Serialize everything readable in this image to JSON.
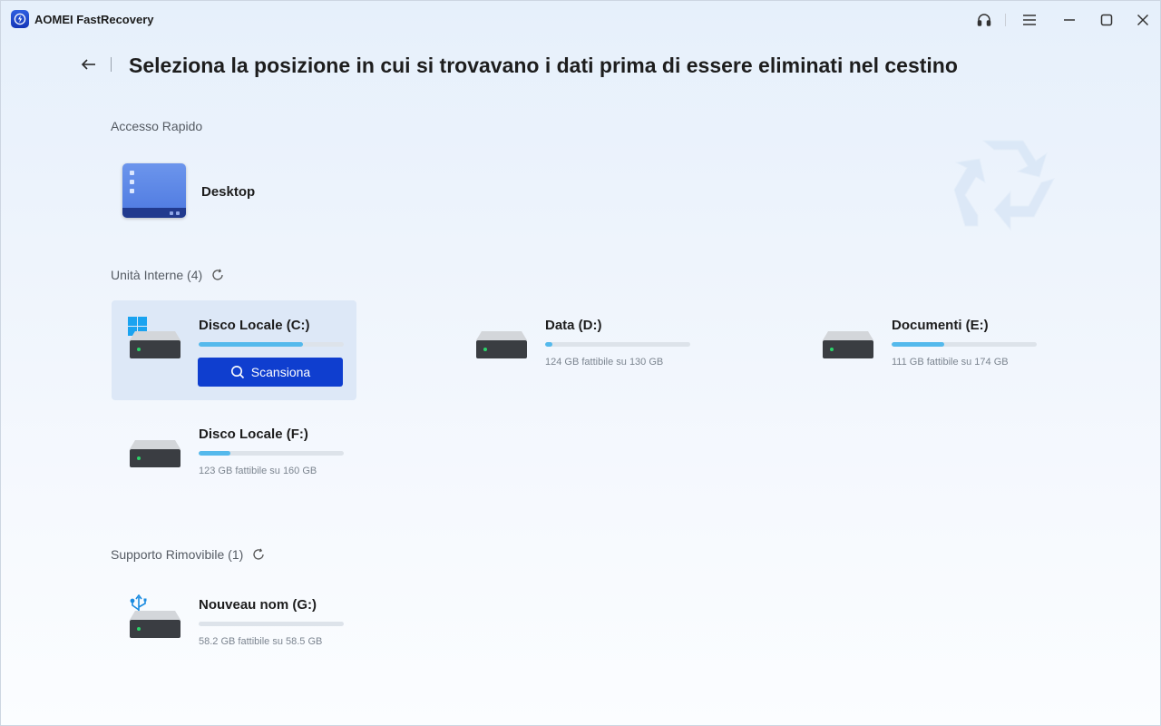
{
  "app": {
    "title": "AOMEI FastRecovery"
  },
  "titlebar": {
    "icons": [
      "support-headset-icon",
      "menu-icon",
      "minimize-icon",
      "maximize-icon",
      "close-icon"
    ]
  },
  "header": {
    "title": "Seleziona la posizione in cui si trovavano i dati prima di essere eliminati nel cestino"
  },
  "quick_access": {
    "label": "Accesso Rapido",
    "items": [
      {
        "label": "Desktop",
        "icon": "desktop-icon"
      }
    ]
  },
  "internal": {
    "label": "Unità Interne (4)",
    "drives": [
      {
        "name": "Disco Locale (C:)",
        "used_fraction": 0.72,
        "capacity": "",
        "selected": true,
        "scan_label": "Scansiona"
      },
      {
        "name": "Data (D:)",
        "used_fraction": 0.05,
        "capacity": "124 GB fattibile su 130 GB"
      },
      {
        "name": "Documenti (E:)",
        "used_fraction": 0.36,
        "capacity": "111 GB fattibile su 174 GB"
      },
      {
        "name": "Disco Locale (F:)",
        "used_fraction": 0.22,
        "capacity": "123 GB fattibile su 160 GB"
      }
    ]
  },
  "removable": {
    "label": "Supporto Rimovibile (1)",
    "drives": [
      {
        "name": "Nouveau nom (G:)",
        "used_fraction": 0.0,
        "capacity": "58.2 GB fattibile su 58.5 GB"
      }
    ]
  },
  "colors": {
    "accent": "#0f3ecf",
    "progress": "#54b9ec",
    "selected_bg": "#dde8f7"
  }
}
